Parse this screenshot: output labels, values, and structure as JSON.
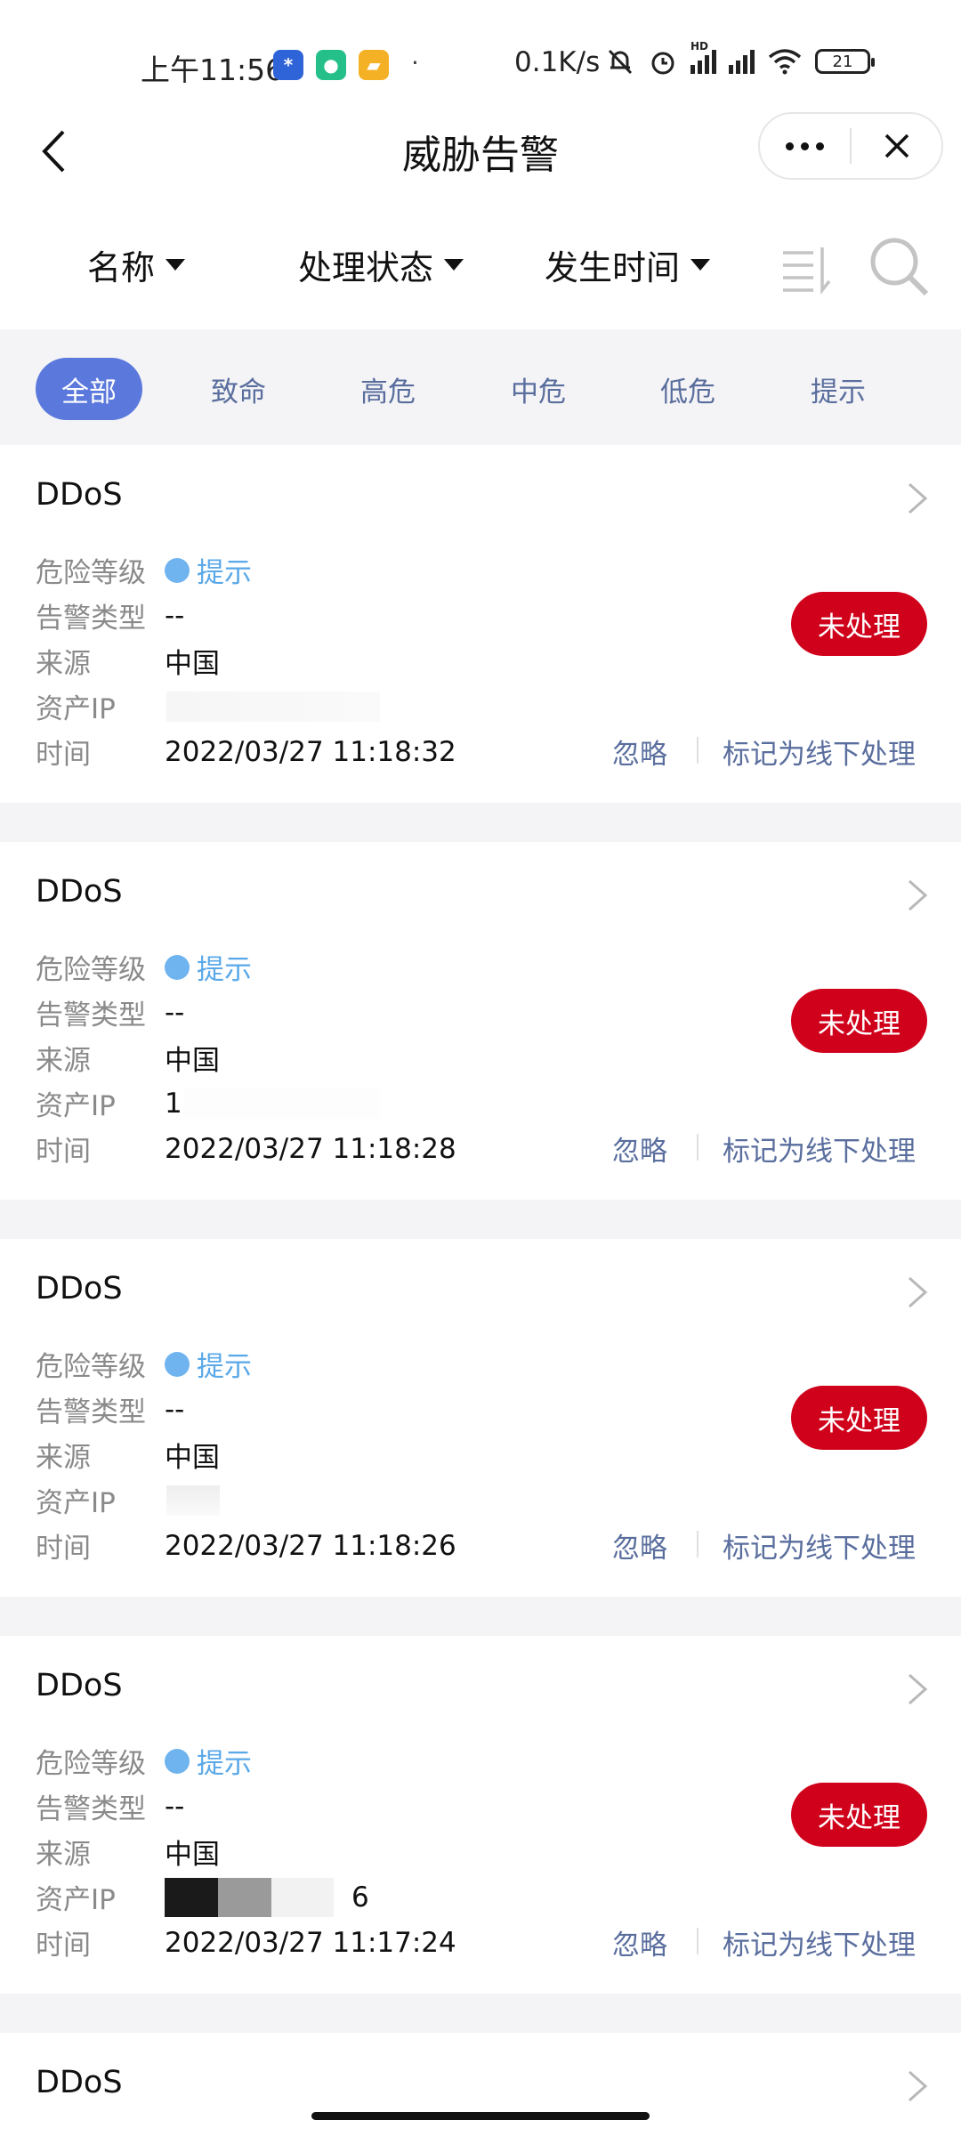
{
  "status_bar": {
    "time": "上午11:56",
    "dot": "·",
    "net_speed": "0.1K/s",
    "battery": "21",
    "hd_label": "HD"
  },
  "nav": {
    "title": "威胁告警",
    "back_icon": "chevron-left-icon",
    "more_icon": "more-dots-icon",
    "close_icon": "close-icon"
  },
  "filters": [
    {
      "label": "名称"
    },
    {
      "label": "处理状态"
    },
    {
      "label": "发生时间"
    }
  ],
  "tabs": [
    {
      "label": "全部",
      "active": true
    },
    {
      "label": "致命",
      "active": false
    },
    {
      "label": "高危",
      "active": false
    },
    {
      "label": "中危",
      "active": false
    },
    {
      "label": "低危",
      "active": false
    },
    {
      "label": "提示",
      "active": false
    }
  ],
  "field_labels": {
    "level": "危险等级",
    "type": "告警类型",
    "source": "来源",
    "ip": "资产IP",
    "time": "时间"
  },
  "actions": {
    "ignore": "忽略",
    "mark_offline": "标记为线下处理"
  },
  "alerts": [
    {
      "name": "DDoS",
      "level": "提示",
      "type": "--",
      "source": "中国",
      "ip": "",
      "time": "2022/03/27 11:18:32",
      "status": "未处理"
    },
    {
      "name": "DDoS",
      "level": "提示",
      "type": "--",
      "source": "中国",
      "ip": "1",
      "time": "2022/03/27 11:18:28",
      "status": "未处理"
    },
    {
      "name": "DDoS",
      "level": "提示",
      "type": "--",
      "source": "中国",
      "ip": "",
      "time": "2022/03/27 11:18:26",
      "status": "未处理"
    },
    {
      "name": "DDoS",
      "level": "提示",
      "type": "--",
      "source": "中国",
      "ip": "6",
      "time": "2022/03/27 11:17:24",
      "status": "未处理"
    },
    {
      "name": "DDoS"
    }
  ],
  "colors": {
    "accent": "#5b78dd",
    "status_unhandled": "#d0021b",
    "level_hint": "#5aa8e8",
    "link": "#5a6e9e"
  }
}
